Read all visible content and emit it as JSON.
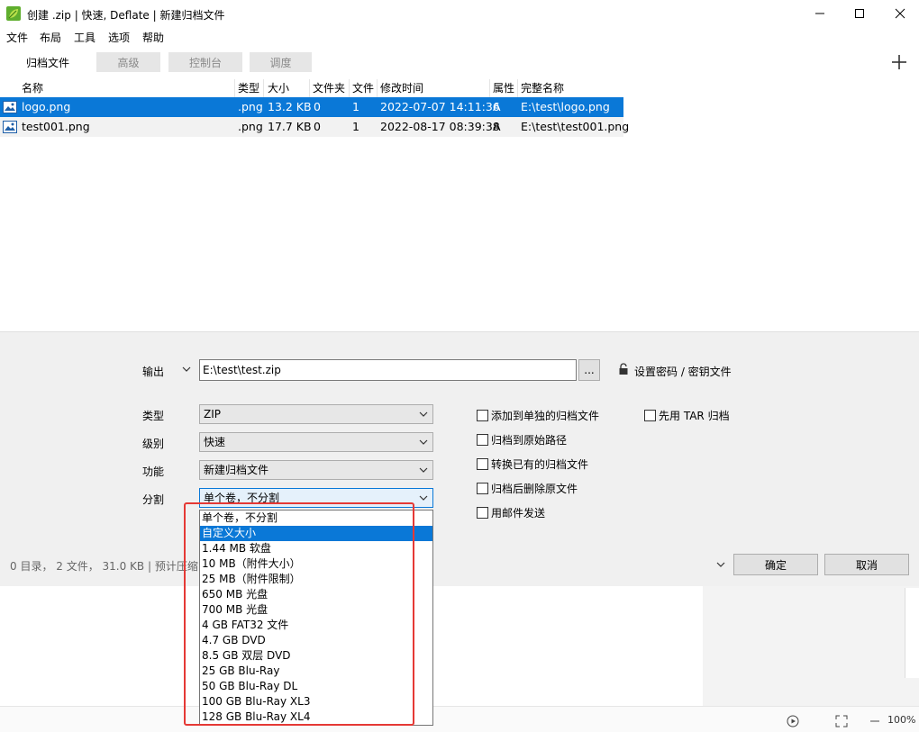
{
  "window": {
    "title": "创建 .zip | 快速, Deflate | 新建归档文件",
    "icon": "app-leaf-icon"
  },
  "menu": [
    "文件",
    "布局",
    "工具",
    "选项",
    "帮助"
  ],
  "tabs": [
    {
      "label": "归档文件",
      "active": true
    },
    {
      "label": "高级",
      "active": false
    },
    {
      "label": "控制台",
      "active": false
    },
    {
      "label": "调度",
      "active": false
    }
  ],
  "table": {
    "columns": [
      "名称",
      "类型",
      "大小",
      "文件夹",
      "文件",
      "修改时间",
      "属性",
      "完整名称"
    ],
    "rows": [
      {
        "name": "logo.png",
        "type": ".png",
        "size": "13.2 KB",
        "folders": "0",
        "files": "1",
        "modified": "2022-07-07 14:11:36",
        "attr": "A",
        "fullname": "E:\\test\\logo.png",
        "selected": true
      },
      {
        "name": "test001.png",
        "type": ".png",
        "size": "17.7 KB",
        "folders": "0",
        "files": "1",
        "modified": "2022-08-17 08:39:38",
        "attr": "A",
        "fullname": "E:\\test\\test001.png",
        "selected": false
      }
    ]
  },
  "output": {
    "label": "输出",
    "value": "E:\\test\\test.zip",
    "browse_label": "...",
    "password_label": "设置密码 / 密钥文件"
  },
  "form": {
    "type_label": "类型",
    "type_value": "ZIP",
    "level_label": "级别",
    "level_value": "快速",
    "function_label": "功能",
    "function_value": "新建归档文件",
    "split_label": "分割",
    "split_value": "单个卷，不分割"
  },
  "checkboxes": {
    "add_separate": "添加到单独的归档文件",
    "archive_original_path": "归档到原始路径",
    "convert_existing": "转换已有的归档文件",
    "delete_after": "归档后删除原文件",
    "send_mail": "用邮件发送",
    "tar_first": "先用 TAR 归档"
  },
  "status": "0 目录， 2 文件， 31.0 KB | 预计压缩",
  "buttons": {
    "ok": "确定",
    "cancel": "取消"
  },
  "split_options": [
    "单个卷，不分割",
    "自定义大小",
    "1.44 MB 软盘",
    "10 MB（附件大小）",
    "25 MB（附件限制）",
    "650 MB 光盘",
    "700 MB 光盘",
    "4 GB FAT32 文件",
    "4.7 GB DVD",
    "8.5 GB 双层 DVD",
    "25 GB Blu-Ray",
    "50 GB Blu-Ray DL",
    "100 GB Blu-Ray XL3",
    "128 GB Blu-Ray XL4"
  ],
  "split_selected_index": 1,
  "background_status": {
    "zoom": "100%"
  },
  "colors": {
    "selection": "#0a78d7",
    "highlight_border": "#e53935",
    "panel": "#f0f0f0"
  }
}
